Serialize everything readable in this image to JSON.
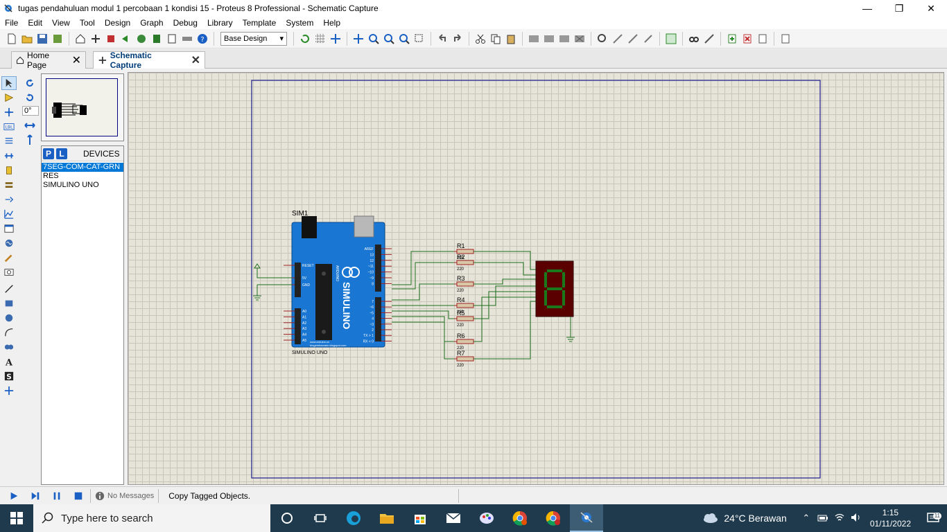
{
  "window": {
    "title": "tugas pendahuluan modul 1 percobaan 1 kondisi 15 - Proteus 8 Professional - Schematic Capture",
    "minimize": "—",
    "restore": "❐",
    "close": "✕"
  },
  "menu": [
    "File",
    "Edit",
    "View",
    "Tool",
    "Design",
    "Graph",
    "Debug",
    "Library",
    "Template",
    "System",
    "Help"
  ],
  "toolbar": {
    "design_select": "Base Design"
  },
  "tabs": [
    {
      "label": "Home Page",
      "close": "✕"
    },
    {
      "label": "Schematic Capture",
      "close": "✕"
    }
  ],
  "rotate": {
    "angle": "0°"
  },
  "devices": {
    "p_label": "P",
    "l_label": "L",
    "title": "DEVICES",
    "items": [
      "7SEG-COM-CAT-GRN",
      "RES",
      "SIMULINO UNO"
    ]
  },
  "schematic": {
    "sim_label": "SIM1",
    "board_label": "SIMULINO UNO",
    "brand_text": "SIMULINO",
    "arduino_text": "ARDUINO",
    "site1": "www.arduino.cc",
    "site2": "blogembarcado.blogspot.com",
    "resistors": [
      {
        "name": "R1",
        "value": "220"
      },
      {
        "name": "R2",
        "value": "220"
      },
      {
        "name": "R3",
        "value": "220"
      },
      {
        "name": "R4",
        "value": "220"
      },
      {
        "name": "R5",
        "value": "220"
      },
      {
        "name": "R6",
        "value": "220"
      },
      {
        "name": "R7",
        "value": "220"
      }
    ],
    "pin_labels_right": [
      "AREF",
      "13",
      "12",
      "~11",
      "~10",
      "~9",
      "8",
      "7",
      "~6",
      "~5",
      "4",
      "~3",
      "2",
      "TX > 1",
      "RX < 0"
    ],
    "pin_labels_left": [
      "RESET",
      "5V",
      "GND",
      "A0",
      "A1",
      "A2",
      "A3",
      "A4",
      "A5"
    ],
    "seg_digit": "8"
  },
  "status": {
    "messages": "No Messages",
    "text": "Copy Tagged Objects."
  },
  "taskbar": {
    "search_placeholder": "Type here to search",
    "weather": "24°C  Berawan",
    "time": "1:15",
    "date": "01/11/2022",
    "notif_count": "11"
  },
  "colors": {
    "accent": "#1a5fc4",
    "canvas": "#e6e4d8",
    "wire": "#1e6e1e",
    "board": "#1976d2",
    "seg_bg": "#5a0000",
    "seg_on": "#1a7a1a"
  }
}
